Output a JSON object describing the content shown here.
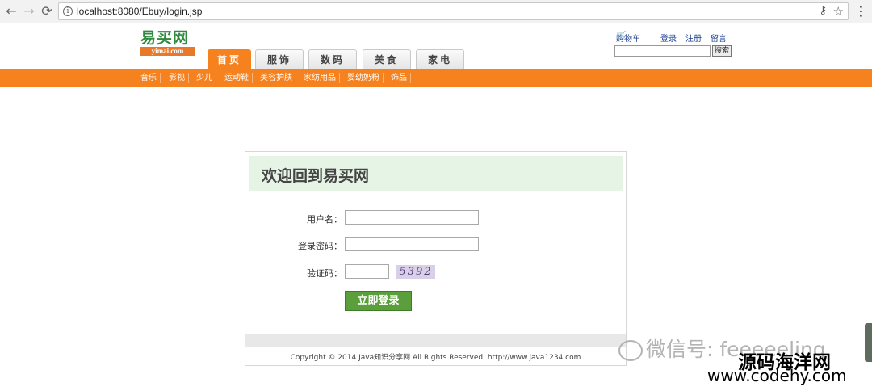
{
  "browser": {
    "url": "localhost:8080/Ebuy/login.jsp",
    "back_icon": "←",
    "forward_icon": "→",
    "reload_icon": "⟳",
    "info_icon": "i",
    "key_icon": "⚷",
    "star_icon": "☆",
    "menu_icon": "⋮"
  },
  "site": {
    "logo_cn": "易买网",
    "logo_en": "yimai.com",
    "tabs": [
      "首页",
      "服饰",
      "数码",
      "美食",
      "家电"
    ],
    "top_links": {
      "cart": "购物车",
      "login": "登录",
      "register": "注册",
      "message": "留言"
    },
    "search_button": "搜索",
    "categories": [
      "音乐",
      "影视",
      "少儿",
      "运动鞋",
      "美容护肤",
      "家纺用品",
      "婴幼奶粉",
      "饰品"
    ]
  },
  "login": {
    "title": "欢迎回到易买网",
    "username_label": "用户名：",
    "password_label": "登录密码：",
    "captcha_label": "验证码：",
    "captcha_text": "5392",
    "submit_label": "立即登录",
    "copyright": "Copyright © 2014 Java知识分享网 All Rights Reserved. http://www.java1234.com"
  },
  "watermark": {
    "wechat": "微信号: feeeeeling",
    "site": "源码海洋网",
    "url": "www.codehy.com"
  }
}
